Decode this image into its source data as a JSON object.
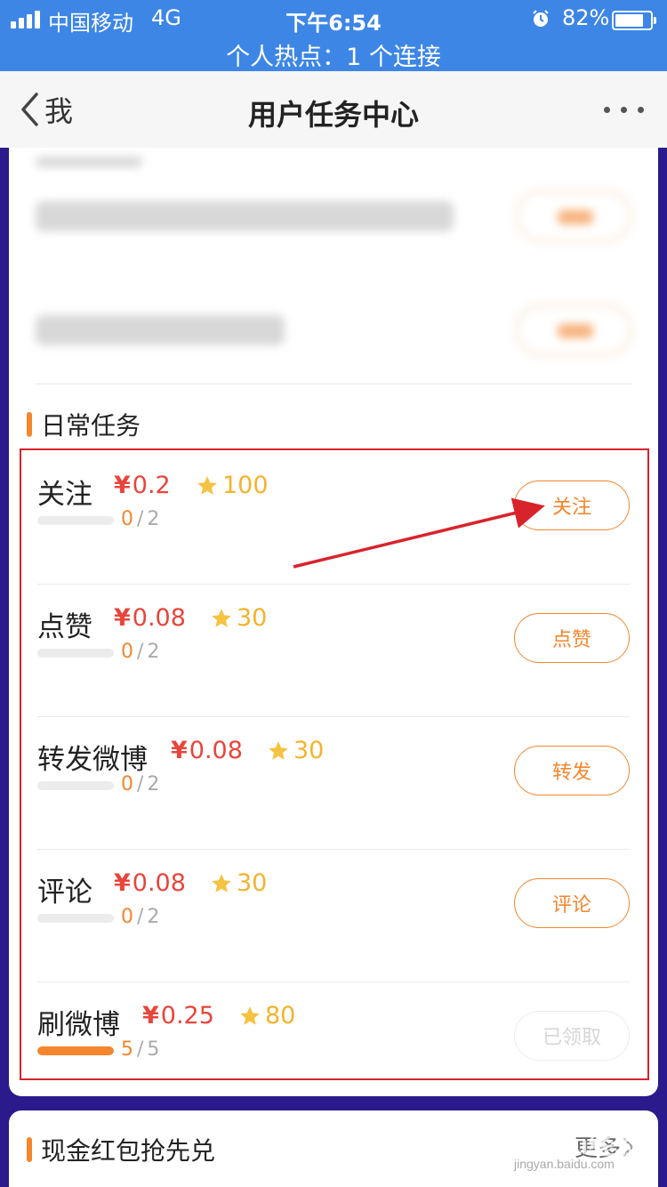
{
  "status_bar": {
    "carrier": "中国移动",
    "network": "4G",
    "time": "下午6:54",
    "battery": "82%",
    "battery_level": 0.82,
    "hotspot": "个人热点：1 个连接"
  },
  "nav": {
    "back_label": "我",
    "title": "用户任务中心"
  },
  "daily_section": {
    "title": "日常任务",
    "tasks": [
      {
        "name": "关注",
        "money": "0.2",
        "stars": "100",
        "done": "0",
        "total": "2",
        "progress": 0,
        "button": "关注",
        "button_state": "active"
      },
      {
        "name": "点赞",
        "money": "0.08",
        "stars": "30",
        "done": "0",
        "total": "2",
        "progress": 0,
        "button": "点赞",
        "button_state": "active"
      },
      {
        "name": "转发微博",
        "money": "0.08",
        "stars": "30",
        "done": "0",
        "total": "2",
        "progress": 0,
        "button": "转发",
        "button_state": "active"
      },
      {
        "name": "评论",
        "money": "0.08",
        "stars": "30",
        "done": "0",
        "total": "2",
        "progress": 0,
        "button": "评论",
        "button_state": "active"
      },
      {
        "name": "刷微博",
        "money": "0.25",
        "stars": "80",
        "done": "5",
        "total": "5",
        "progress": 1,
        "button": "已领取",
        "button_state": "disabled"
      }
    ]
  },
  "cash_section": {
    "title": "现金红包抢先兑",
    "more": "更多"
  },
  "currency_symbol": "¥",
  "progress_separator": "/",
  "watermark": {
    "brand": "Baidu经验",
    "url": "jingyan.baidu.com"
  },
  "colors": {
    "status_bar": "#3d86e6",
    "accent_orange": "#f5862d",
    "money_red": "#e8453c",
    "star_yellow": "#f4b32d",
    "highlight_red": "#d9232b",
    "background": "#2a1a8c"
  }
}
